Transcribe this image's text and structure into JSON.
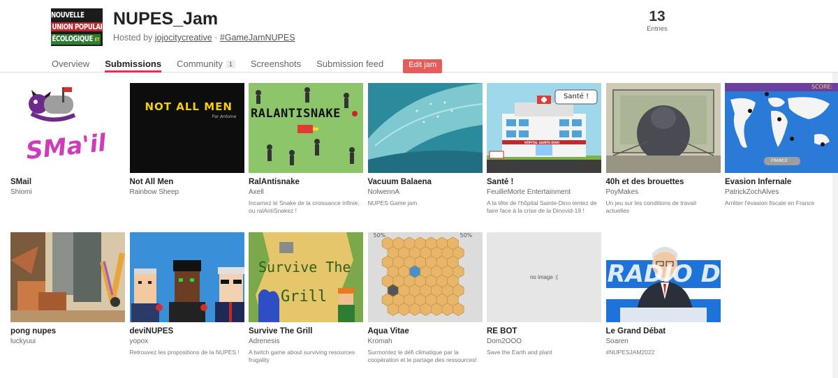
{
  "header": {
    "logo_text": [
      "NOUVELLE",
      "UNION POPULAIRE",
      "ÉCOLOGIQUE"
    ],
    "logo_small": "ET",
    "title": "NUPES_Jam",
    "hosted_by_label": "Hosted by",
    "host": "jojocitycreative",
    "separator": "·",
    "hashtag": "#GameJamNUPES",
    "entries_count": "13",
    "entries_label": "Entries"
  },
  "nav": {
    "tabs": [
      {
        "label": "Overview"
      },
      {
        "label": "Submissions"
      },
      {
        "label": "Community",
        "count": "1"
      },
      {
        "label": "Screenshots"
      },
      {
        "label": "Submission feed"
      }
    ],
    "edit_label": "Edit jam"
  },
  "games": [
    {
      "title": "SMail",
      "author": "Shiomi",
      "desc": ""
    },
    {
      "title": "Not All Men",
      "author": "Rainbow Sheep",
      "desc": ""
    },
    {
      "title": "RalAntisnake",
      "author": "Axell",
      "desc": "Incarnez le Snake de la croissance infinie, ou ralAntiSnakez !"
    },
    {
      "title": "Vacuum Balaena",
      "author": "NolwennA",
      "desc": "NUPES Game jam"
    },
    {
      "title": "Santé !",
      "author": "FeuilleMorte Entertainment",
      "desc": "A la tête de l'hôpital Sainte-Dino tentez de faire face à la crise de la Dinovid-19 !"
    },
    {
      "title": "40h et des brouettes",
      "author": "PoyMakes",
      "desc": "Un jeu sur les conditions de travail actuelles"
    },
    {
      "title": "Evasion Infernale",
      "author": "PatrickZochAlves",
      "desc": "Arrêter l'évasion fiscale en France"
    },
    {
      "title": "pong nupes",
      "author": "luckyuui",
      "desc": ""
    },
    {
      "title": "deviNUPES",
      "author": "yopox",
      "desc": "Retrouvez les propositions de la NUPES !"
    },
    {
      "title": "Survive The Grill",
      "author": "Adrenesis",
      "desc": "A twitch game about surviving resources frugality"
    },
    {
      "title": "Aqua Vitae",
      "author": "Kromah",
      "desc": "Surmontez le défi climatique par la coopération et le partage des ressources!"
    },
    {
      "title": "RE BOT",
      "author": "Dom2OOO",
      "desc": "Save the Earth and plant"
    },
    {
      "title": "Le Grand Débat",
      "author": "Soaren",
      "desc": "#NUPESJAM2022"
    }
  ],
  "thumb_text": {
    "smail": "SMa'il",
    "notall": "NOT  ALL  MEN",
    "notall_sub": "Par Antoine",
    "ralanti": "RALANTISNAKE",
    "sante_bubble": "Santé !",
    "sante_sign": "HÔPITAL SAINTE-DINO",
    "evasion_score": "SCORE:",
    "evasion_france": "FRANCE",
    "survive_line1": "Survive The",
    "survive_line2": "Grill",
    "aqua_left": "50%",
    "aqua_right": "50%",
    "rebot_noimage": "no image :(",
    "debat_banner": "RADIO D"
  }
}
